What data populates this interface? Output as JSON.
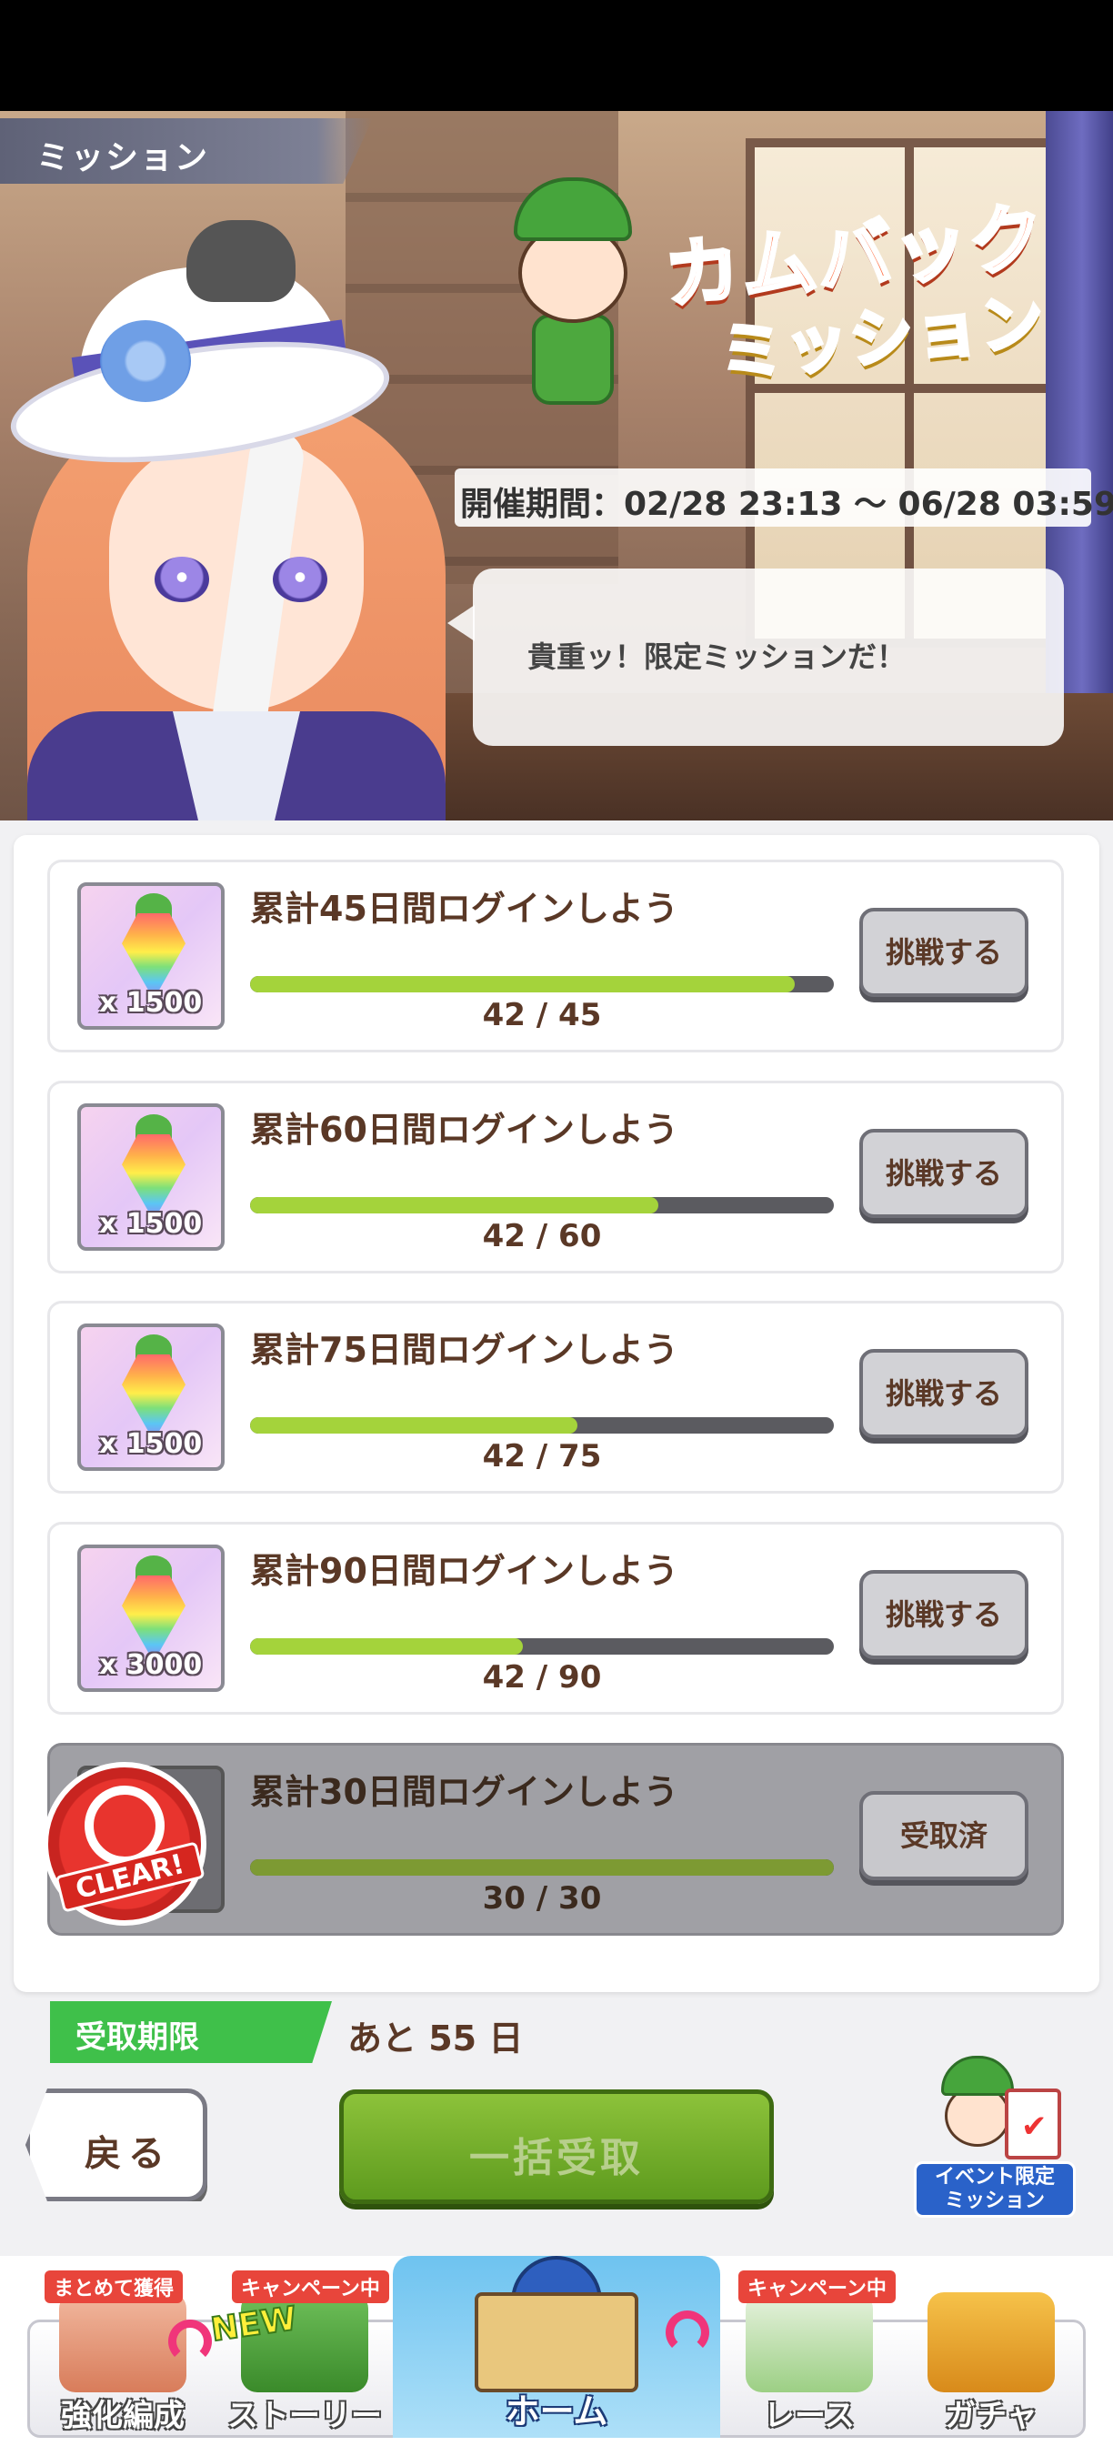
{
  "header": {
    "screen_title": "ミッション"
  },
  "banner": {
    "logo_line1": "カムバック",
    "logo_line2": "ミッション",
    "period": "開催期間：02/28 23:13 ～ 06/28 03:59",
    "speech": "貴重ッ！限定ミッションだ！"
  },
  "missions": [
    {
      "title": "累計45日間ログインしよう",
      "reward_qty": "x 1500",
      "progress": "42 / 45",
      "progress_ratio": 0.933,
      "button": "挑戦する",
      "cleared": false
    },
    {
      "title": "累計60日間ログインしよう",
      "reward_qty": "x 1500",
      "progress": "42 / 60",
      "progress_ratio": 0.7,
      "button": "挑戦する",
      "cleared": false
    },
    {
      "title": "累計75日間ログインしよう",
      "reward_qty": "x 1500",
      "progress": "42 / 75",
      "progress_ratio": 0.56,
      "button": "挑戦する",
      "cleared": false
    },
    {
      "title": "累計90日間ログインしよう",
      "reward_qty": "x 3000",
      "progress": "42 / 90",
      "progress_ratio": 0.467,
      "button": "挑戦する",
      "cleared": false
    },
    {
      "title": "累計30日間ログインしよう",
      "reward_qty": "",
      "progress": "30 / 30",
      "progress_ratio": 1.0,
      "button": "受取済",
      "cleared": true,
      "stamp": "CLEAR!"
    }
  ],
  "footer": {
    "deadline_label": "受取期限",
    "deadline_value": "あと 55 日",
    "back": "戻る",
    "claim_all": "一括受取",
    "event_mission_line1": "イベント限定",
    "event_mission_line2": "ミッション"
  },
  "nav": {
    "items": [
      {
        "label": "強化編成",
        "badge": "まとめて獲得"
      },
      {
        "label": "ストーリー",
        "badge": "キャンペーン中",
        "new": "NEW"
      },
      {
        "label": "ホーム"
      },
      {
        "label": "レース",
        "badge": "キャンペーン中"
      },
      {
        "label": "ガチャ"
      }
    ]
  },
  "colors": {
    "progress_fill": "#a4d33b",
    "deadline_tag": "#3fc04a",
    "claim_button": "#6aa82a",
    "accent_text": "#5a3826"
  }
}
